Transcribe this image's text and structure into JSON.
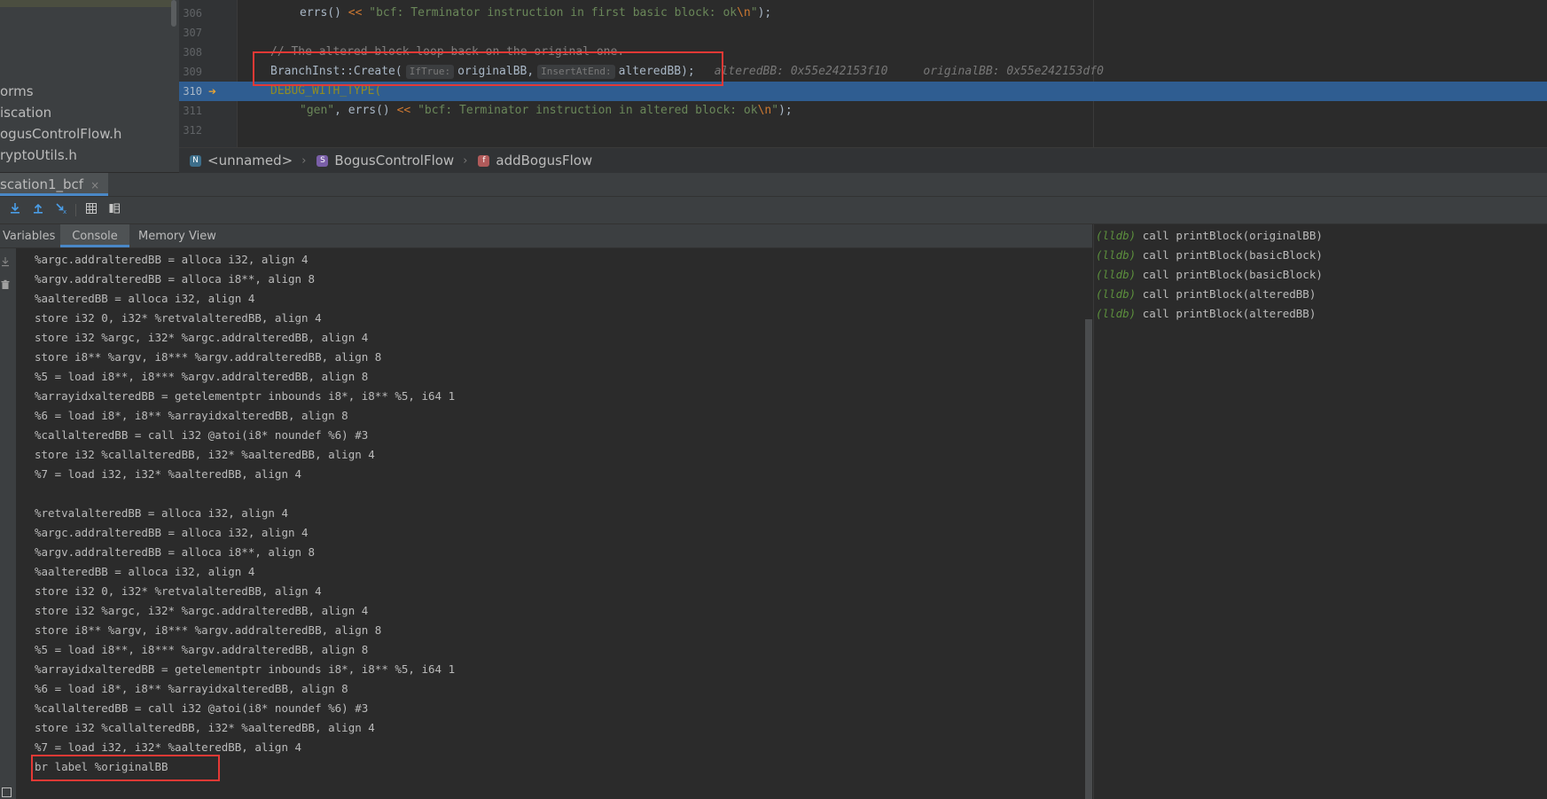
{
  "project_tree": {
    "items": [
      "orms",
      "iscation",
      "ogusControlFlow.h",
      "ryptoUtils.h"
    ]
  },
  "editor": {
    "lines": [
      {
        "num": "306",
        "parts": [
          {
            "t": "errs() ",
            "c": ""
          },
          {
            "t": "<<",
            "c": "op"
          },
          {
            "t": " \"bcf: Terminator instruction in first basic block: ok",
            "c": "str"
          },
          {
            "t": "\\n",
            "c": "esc"
          },
          {
            "t": "\"",
            "c": "str"
          },
          {
            "t": ");",
            "c": ""
          }
        ],
        "indent": 1
      },
      {
        "num": "307",
        "parts": [],
        "indent": 0
      },
      {
        "num": "308",
        "parts": [
          {
            "t": "// The altered block loop back on the original one.",
            "c": "com"
          }
        ],
        "indent": 0
      },
      {
        "num": "309",
        "special": "create"
      },
      {
        "num": "310",
        "parts": [
          {
            "t": "DEBUG_WITH_TYPE(",
            "c": "macro"
          }
        ],
        "indent": 0,
        "current": true
      },
      {
        "num": "311",
        "parts": [
          {
            "t": "\"gen\"",
            "c": "str"
          },
          {
            "t": ", errs() ",
            "c": ""
          },
          {
            "t": "<<",
            "c": "op"
          },
          {
            "t": " \"bcf: Terminator instruction in altered block: ok",
            "c": "str"
          },
          {
            "t": "\\n",
            "c": "esc"
          },
          {
            "t": "\"",
            "c": "str"
          },
          {
            "t": ");",
            "c": ""
          }
        ],
        "indent": 1
      },
      {
        "num": "312",
        "parts": [],
        "indent": 0
      }
    ],
    "create_line": {
      "code_start": "BranchInst::Create(",
      "hint1": "IfTrue:",
      "arg1": "originalBB,",
      "hint2": "InsertAtEnd:",
      "arg2": "alteredBB);",
      "val1": "alteredBB: 0x55e242153f10",
      "val2": "originalBB: 0x55e242153df0"
    }
  },
  "breadcrumb": {
    "items": [
      {
        "badge": "N",
        "label": "<unnamed>"
      },
      {
        "badge": "S",
        "label": "BogusControlFlow"
      },
      {
        "badge": "f",
        "label": "addBogusFlow"
      }
    ]
  },
  "debug": {
    "tab_label": "scation1_bcf",
    "close": "×",
    "sub_tabs": [
      "Variables",
      "Console",
      "Memory View"
    ]
  },
  "console": {
    "lines": [
      "%argc.addralteredBB = alloca i32, align 4",
      "%argv.addralteredBB = alloca i8**, align 8",
      "%aalteredBB = alloca i32, align 4",
      "store i32 0, i32* %retvalalteredBB, align 4",
      "store i32 %argc, i32* %argc.addralteredBB, align 4",
      "store i8** %argv, i8*** %argv.addralteredBB, align 8",
      "%5 = load i8**, i8*** %argv.addralteredBB, align 8",
      "%arrayidxalteredBB = getelementptr inbounds i8*, i8** %5, i64 1",
      "%6 = load i8*, i8** %arrayidxalteredBB, align 8",
      "%callalteredBB = call i32 @atoi(i8* noundef %6) #3",
      "store i32 %callalteredBB, i32* %aalteredBB, align 4",
      "%7 = load i32, i32* %aalteredBB, align 4",
      "",
      "%retvalalteredBB = alloca i32, align 4",
      "%argc.addralteredBB = alloca i32, align 4",
      "%argv.addralteredBB = alloca i8**, align 8",
      "%aalteredBB = alloca i32, align 4",
      "store i32 0, i32* %retvalalteredBB, align 4",
      "store i32 %argc, i32* %argc.addralteredBB, align 4",
      "store i8** %argv, i8*** %argv.addralteredBB, align 8",
      "%5 = load i8**, i8*** %argv.addralteredBB, align 8",
      "%arrayidxalteredBB = getelementptr inbounds i8*, i8** %5, i64 1",
      "%6 = load i8*, i8** %arrayidxalteredBB, align 8",
      "%callalteredBB = call i32 @atoi(i8* noundef %6) #3",
      "store i32 %callalteredBB, i32* %aalteredBB, align 4",
      "%7 = load i32, i32* %aalteredBB, align 4",
      "br label %originalBB"
    ]
  },
  "lldb": {
    "prompt": "(lldb)",
    "commands": [
      "call printBlock(originalBB)",
      "call printBlock(basicBlock)",
      "call printBlock(basicBlock)",
      "call printBlock(alteredBB)",
      "call printBlock(alteredBB)"
    ]
  },
  "colors": {
    "accent": "#4a88c7",
    "current_line": "#2f5d91",
    "highlight_box": "#e53935",
    "execution_arrow": "#f0a732"
  },
  "icons": {
    "execution_point": "arrow-right-icon",
    "toolbar": [
      "step-into-icon",
      "step-out-icon",
      "run-to-cursor-icon",
      "evaluate-icon",
      "layout-icon"
    ]
  }
}
